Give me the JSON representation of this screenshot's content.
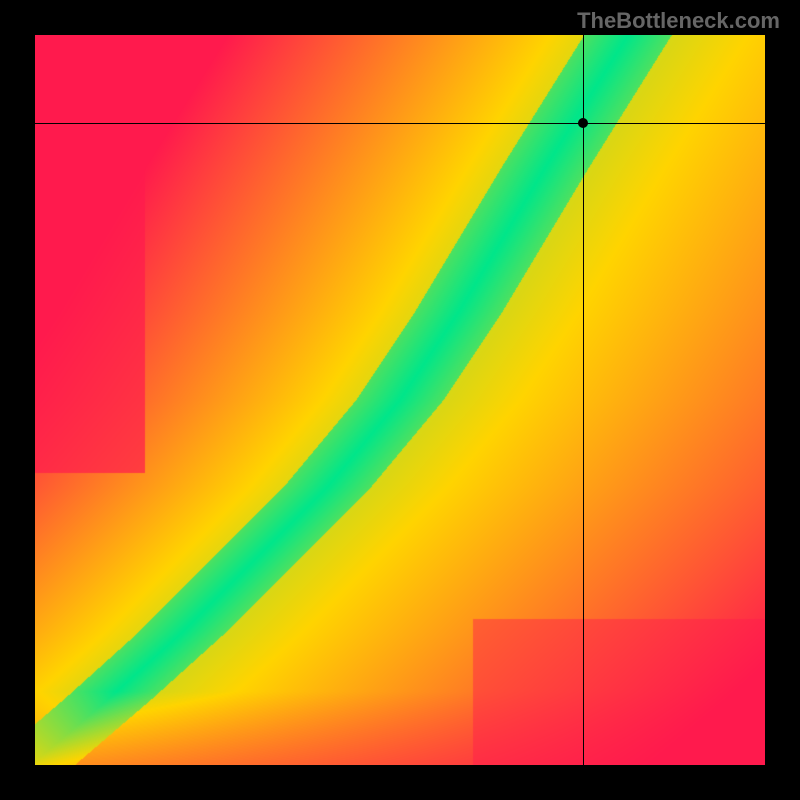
{
  "watermark": "TheBottleneck.com",
  "chart_data": {
    "type": "heatmap",
    "title": "",
    "xlabel": "",
    "ylabel": "",
    "x_range": [
      0,
      100
    ],
    "y_range": [
      0,
      100
    ],
    "crosshair": {
      "x": 75,
      "y": 88
    },
    "marker": {
      "x": 75,
      "y": 88
    },
    "optimal_curve": {
      "description": "Green band running diagonally from bottom-left toward upper-center, curving upward",
      "points_xy": [
        [
          3,
          3
        ],
        [
          10,
          9
        ],
        [
          20,
          18
        ],
        [
          30,
          28
        ],
        [
          40,
          38
        ],
        [
          50,
          50
        ],
        [
          58,
          62
        ],
        [
          64,
          72
        ],
        [
          70,
          82
        ],
        [
          75,
          90
        ],
        [
          80,
          98
        ]
      ],
      "band_halfwidth_x": 6
    },
    "color_scale_endpoints": {
      "worst": "#ff1a4d",
      "mid": "#ffd400",
      "best": "#00e68a"
    },
    "corner_colors_approx": {
      "top_left": "red",
      "top_right": "yellow",
      "bottom_left": "red",
      "bottom_right": "red",
      "center_ridge": "green"
    }
  }
}
